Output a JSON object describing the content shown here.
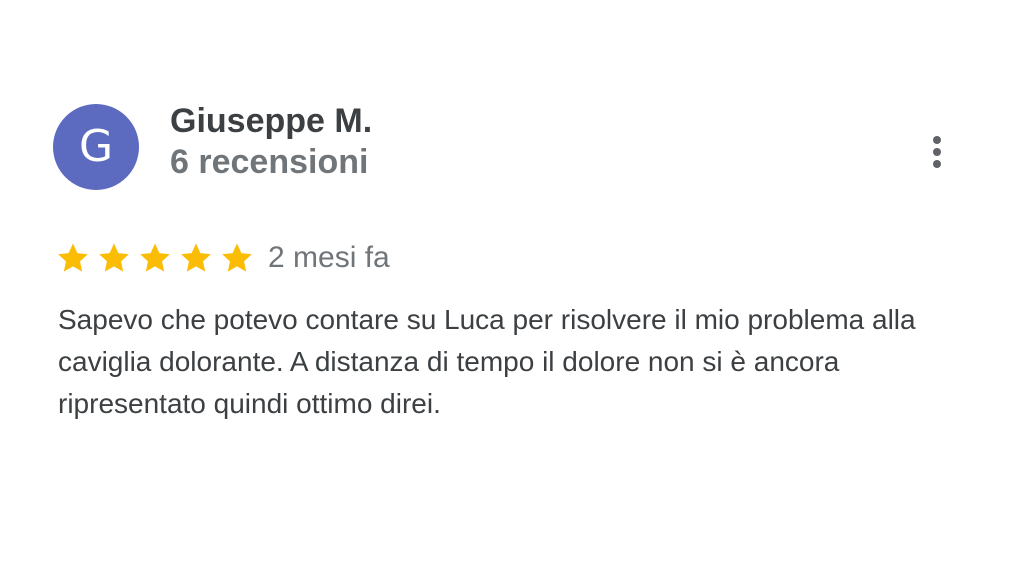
{
  "review": {
    "avatar_letter": "G",
    "author_name": "Giuseppe M.",
    "review_count": "6 recensioni",
    "rating": 5,
    "rating_max": 5,
    "date": "2 mesi fa",
    "text": "Sapevo che potevo contare su Luca per risolvere il mio problema alla caviglia dolorante. A distanza di tempo il dolore non si è ancora ripresentato quindi ottimo direi.",
    "more_icon": "more-vert-icon",
    "star_icon": "star-icon"
  },
  "colors": {
    "avatar_bg": "#5c6bc0",
    "star": "#fbbc04",
    "primary_text": "#3c4043",
    "secondary_text": "#70757a"
  }
}
